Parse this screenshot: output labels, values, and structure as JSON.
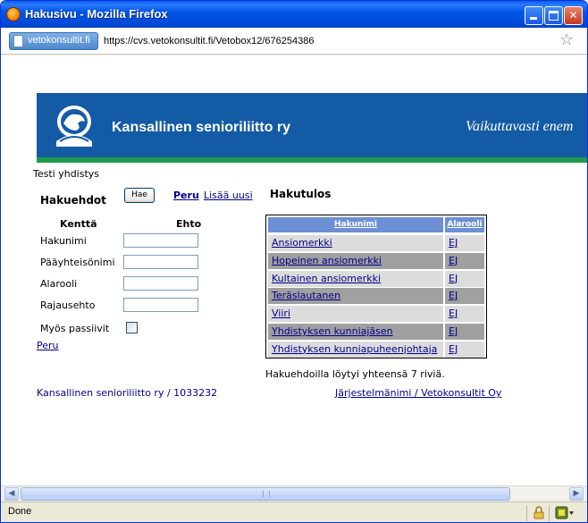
{
  "window": {
    "title": "Hakusivu - Mozilla Firefox"
  },
  "addressbar": {
    "site": "vetokonsultit.fi",
    "url": "https://cvs.vetokonsultit.fi/Vetobox12/676254386"
  },
  "banner": {
    "org_name": "Kansallinen senioriliitto ry",
    "slogan": "Vaikuttavasti enem"
  },
  "page": {
    "association": "Testi yhdistys",
    "criteria_title": "Hakuehdot",
    "search_button": "Hae",
    "cancel_link": "Peru",
    "add_new_link": "Lisää uusi",
    "col_field": "Kenttä",
    "col_condition": "Ehto",
    "fields": [
      {
        "label": "Hakunimi",
        "value": ""
      },
      {
        "label": "Pääyhteisönimi",
        "value": ""
      },
      {
        "label": "Alarooli",
        "value": ""
      },
      {
        "label": "Rajausehto",
        "value": ""
      }
    ],
    "passive_label": "Myös passiivit",
    "passive_checked": false,
    "bottom_cancel_link": "Peru",
    "results_title": "Hakutulos",
    "results_header": [
      "Hakunimi",
      "Alarooli"
    ],
    "results": [
      {
        "name": "Ansiomerkki",
        "role": "EJ"
      },
      {
        "name": "Hopeinen ansiomerkki",
        "role": "EJ"
      },
      {
        "name": "Kultainen ansiomerkki",
        "role": "EJ"
      },
      {
        "name": "Teräslautanen",
        "role": "EJ"
      },
      {
        "name": "Viiri",
        "role": "EJ"
      },
      {
        "name": "Yhdistyksen kunniajäsen",
        "role": "EJ"
      },
      {
        "name": "Yhdistyksen kunniapuheenjohtaja",
        "role": "EJ"
      }
    ],
    "result_count_text": "Hakuehdoilla löytyi yhteensä 7 riviä.",
    "footer_left": "Kansallinen senioriliitto ry / 1033232",
    "footer_right": "Järjestelmänimi / Vetokonsultit Oy"
  },
  "statusbar": {
    "status": "Done"
  },
  "colors": {
    "titlebar": "#0054E3",
    "banner_blue": "#145BA6",
    "banner_green": "#1E9A4A",
    "table_header": "#6C8FD6",
    "row_light": "#DCDCDC",
    "row_dark": "#A0A0A0",
    "link": "#00008B"
  },
  "icons": [
    "firefox-icon",
    "minimize-icon",
    "maximize-icon",
    "close-icon",
    "page-icon",
    "star-icon",
    "lion-emblem-icon",
    "lock-icon",
    "addon-icon"
  ]
}
